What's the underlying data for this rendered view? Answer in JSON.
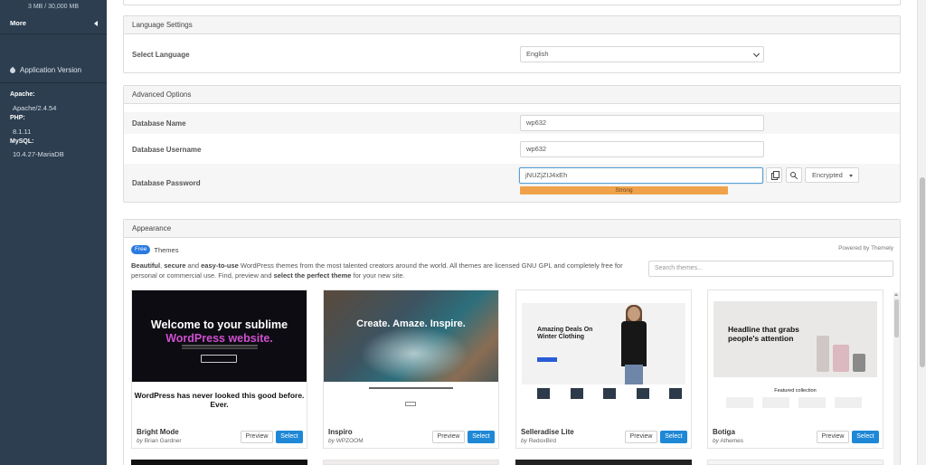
{
  "sidebar": {
    "disk_usage": "3 MB / 30,000 MB",
    "more_label": "More",
    "app_version_title": "Application Version",
    "apache_label": "Apache:",
    "apache_value": "Apache/2.4.54",
    "php_label": "PHP:",
    "php_value": "8.1.11",
    "mysql_label": "MySQL:",
    "mysql_value": "10.4.27-MariaDB"
  },
  "language": {
    "section_title": "Language Settings",
    "select_label": "Select Language",
    "selected": "English"
  },
  "advanced": {
    "section_title": "Advanced Options",
    "db_name_label": "Database Name",
    "db_name_value": "wp632",
    "db_user_label": "Database Username",
    "db_user_value": "wp632",
    "db_pass_label": "Database Password",
    "db_pass_value": "jNUZjZIJ4xEh",
    "strength_text": "Strong",
    "encryption_selected": "Encrypted"
  },
  "appearance": {
    "section_title": "Appearance",
    "free_badge": "Free",
    "themes_label": "Themes",
    "powered_by": "Powered by Themely",
    "desc_b1": "Beautiful",
    "desc_t1": ", ",
    "desc_b2": "secure",
    "desc_t2": " and ",
    "desc_b3": "easy-to-use",
    "desc_t3": " WordPress themes from the most talented creators around the world. All themes are licensed GNU GPL and completely free for personal or commercial use. Find, preview and ",
    "desc_b4": "select the perfect theme",
    "desc_t4": " for your new site.",
    "search_placeholder": "Search themes...",
    "preview_label": "Preview",
    "select_label": "Select",
    "by_prefix": "by",
    "themes": [
      {
        "name": "Bright Mode",
        "author": "Brian Gardner",
        "headline_a": "Welcome to your sublime",
        "headline_b": "WordPress website.",
        "subline": "WordPress has never looked this good before. Ever."
      },
      {
        "name": "Inspiro",
        "author": "WPZOOM",
        "headline_a": "Create. Amaze. Inspire."
      },
      {
        "name": "Selleradise Lite",
        "author": "RedoxBird",
        "headline_a": "Amazing Deals On Winter Clothing"
      },
      {
        "name": "Botiga",
        "author": "Athemes",
        "headline_a": "Headline that grabs people's attention",
        "subline": "Featured collection"
      }
    ]
  }
}
